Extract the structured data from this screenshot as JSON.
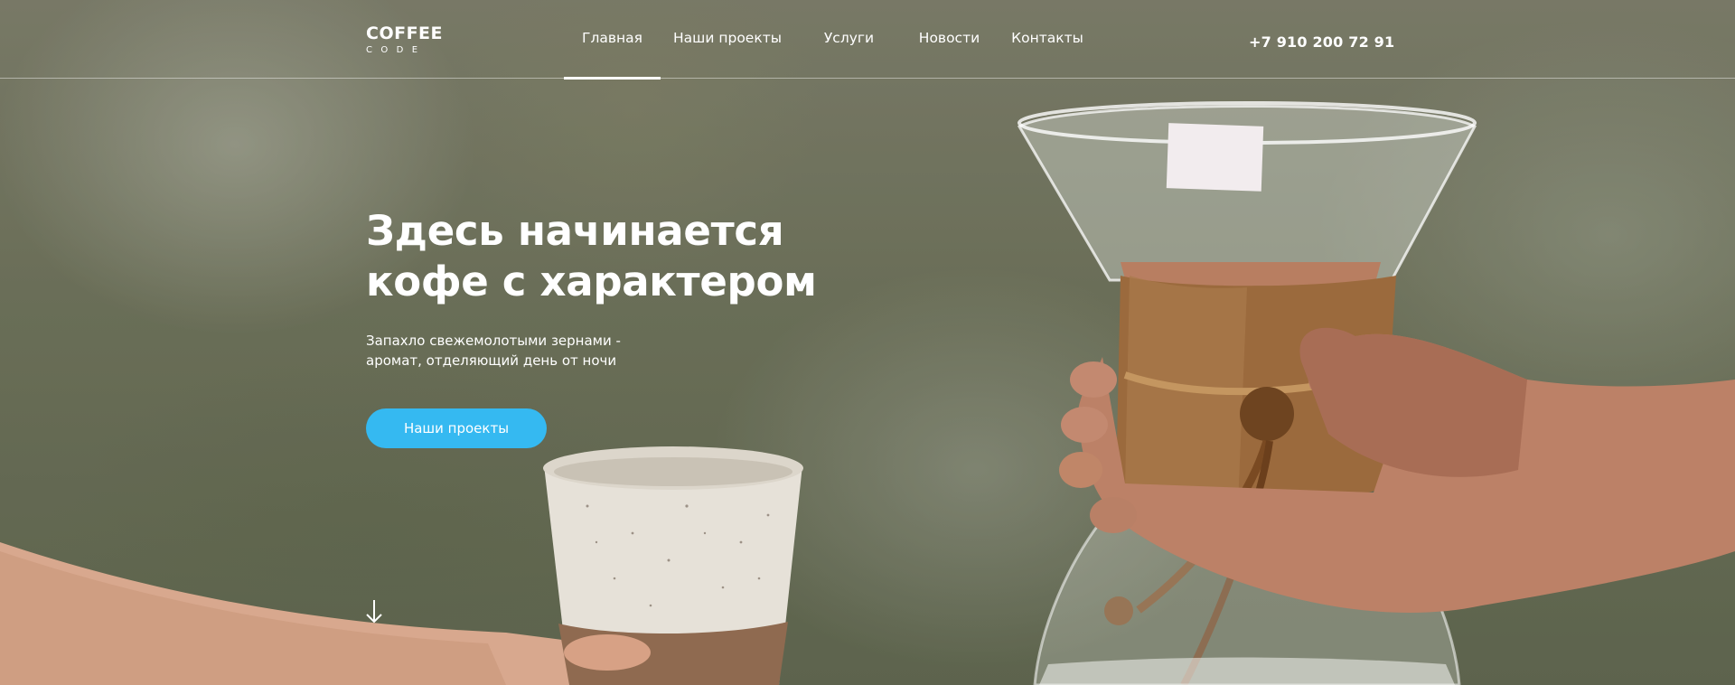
{
  "header": {
    "logo": {
      "top": "COFFEE",
      "bottom": "CODE"
    },
    "nav": [
      {
        "label": "Главная",
        "active": true
      },
      {
        "label": "Наши проекты",
        "active": false
      },
      {
        "label": "Услуги",
        "active": false
      },
      {
        "label": "Новости",
        "active": false
      },
      {
        "label": "Контакты",
        "active": false
      }
    ],
    "phone": "+7 910 200 72 91"
  },
  "hero": {
    "title_line1": "Здесь начинается",
    "title_line2": "кофе с характером",
    "subtitle_line1": "Запахло свежемолотыми зернами -",
    "subtitle_line2": "аромат, отделяющий день от ночи",
    "cta_label": "Наши проекты",
    "scroll_icon": "arrow-down-icon"
  },
  "colors": {
    "accent": "#35b9f1",
    "text": "#ffffff"
  }
}
